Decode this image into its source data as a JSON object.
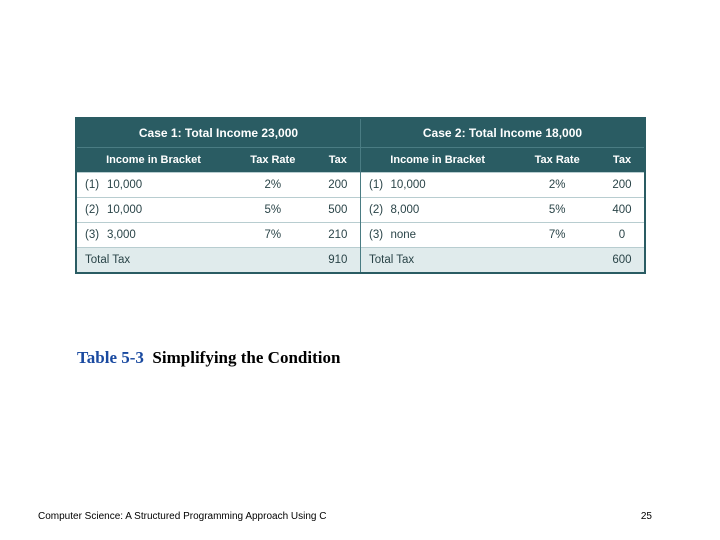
{
  "table": {
    "case1_header": "Case 1: Total Income 23,000",
    "case2_header": "Case 2: Total Income 18,000",
    "col_income": "Income in Bracket",
    "col_rate": "Tax Rate",
    "col_tax": "Tax",
    "rows": [
      {
        "l1": "(1)",
        "i1": "10,000",
        "r1": "2%",
        "t1": "200",
        "l2": "(1)",
        "i2": "10,000",
        "r2": "2%",
        "t2": "200"
      },
      {
        "l1": "(2)",
        "i1": "10,000",
        "r1": "5%",
        "t1": "500",
        "l2": "(2)",
        "i2": "8,000",
        "r2": "5%",
        "t2": "400"
      },
      {
        "l1": "(3)",
        "i1": "3,000",
        "r1": "7%",
        "t1": "210",
        "l2": "(3)",
        "i2": "none",
        "r2": "7%",
        "t2": "0"
      }
    ],
    "total_label": "Total Tax",
    "total1": "910",
    "total2": "600"
  },
  "caption": {
    "label": "Table  5-3",
    "title": "Simplifying the Condition"
  },
  "footer": {
    "book": "Computer Science: A Structured Programming Approach Using C",
    "page": "25"
  },
  "chart_data": {
    "type": "table",
    "title": "Table 5-3 Simplifying the Condition",
    "cases": [
      {
        "name": "Case 1",
        "total_income": 23000,
        "brackets": [
          {
            "bracket": 1,
            "income": 10000,
            "tax_rate": 0.02,
            "tax": 200
          },
          {
            "bracket": 2,
            "income": 10000,
            "tax_rate": 0.05,
            "tax": 500
          },
          {
            "bracket": 3,
            "income": 3000,
            "tax_rate": 0.07,
            "tax": 210
          }
        ],
        "total_tax": 910
      },
      {
        "name": "Case 2",
        "total_income": 18000,
        "brackets": [
          {
            "bracket": 1,
            "income": 10000,
            "tax_rate": 0.02,
            "tax": 200
          },
          {
            "bracket": 2,
            "income": 8000,
            "tax_rate": 0.05,
            "tax": 400
          },
          {
            "bracket": 3,
            "income": null,
            "tax_rate": 0.07,
            "tax": 0
          }
        ],
        "total_tax": 600
      }
    ]
  }
}
